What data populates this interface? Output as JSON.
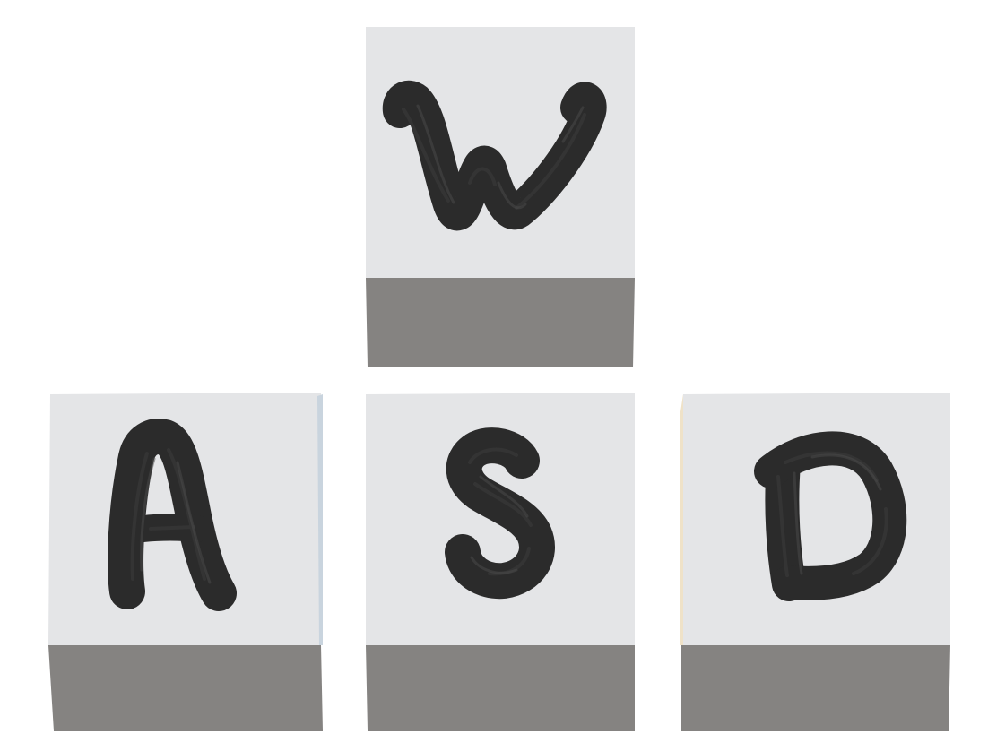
{
  "keys": [
    {
      "id": "w",
      "letter": "w"
    },
    {
      "id": "a",
      "letter": "A"
    },
    {
      "id": "s",
      "letter": "S"
    },
    {
      "id": "d",
      "letter": "D"
    }
  ],
  "colors": {
    "key_top": "#e4e5e7",
    "key_front": "#858381",
    "glyph": "#2b2b2b",
    "background": "#ffffff"
  }
}
